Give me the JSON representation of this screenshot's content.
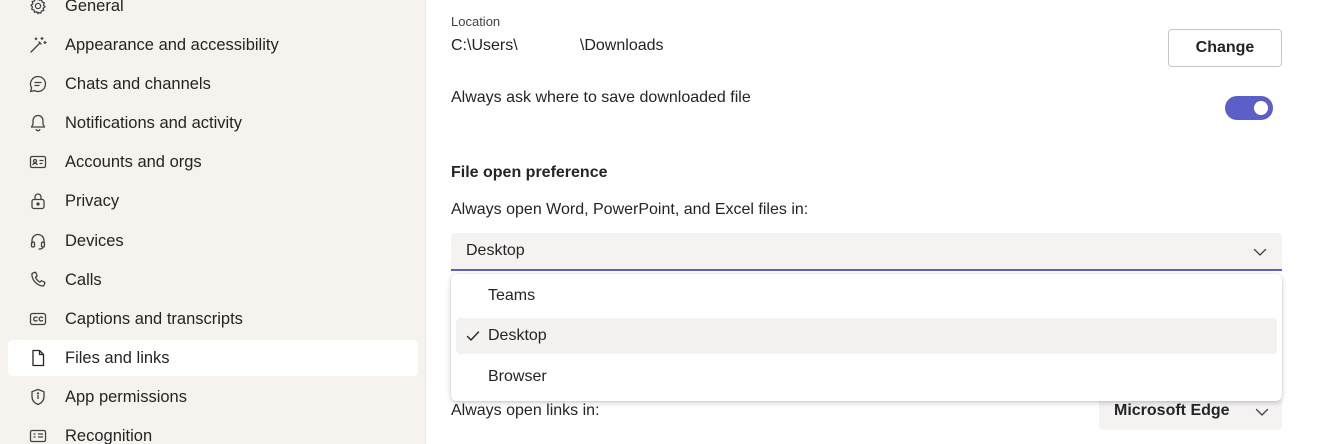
{
  "sidebar": {
    "items": [
      {
        "label": "General",
        "icon": "gear-icon"
      },
      {
        "label": "Appearance and accessibility",
        "icon": "magic-wand-icon"
      },
      {
        "label": "Chats and channels",
        "icon": "chat-icon"
      },
      {
        "label": "Notifications and activity",
        "icon": "bell-icon"
      },
      {
        "label": "Accounts and orgs",
        "icon": "id-card-icon"
      },
      {
        "label": "Privacy",
        "icon": "lock-icon"
      },
      {
        "label": "Devices",
        "icon": "headset-icon"
      },
      {
        "label": "Calls",
        "icon": "phone-icon"
      },
      {
        "label": "Captions and transcripts",
        "icon": "closed-caption-icon"
      },
      {
        "label": "Files and links",
        "icon": "document-icon",
        "selected": true
      },
      {
        "label": "App permissions",
        "icon": "shield-icon"
      },
      {
        "label": "Recognition",
        "icon": "recognition-icon"
      }
    ]
  },
  "main": {
    "location_label": "Location",
    "location_value": "C:\\Users\\              \\Downloads",
    "change_button": "Change",
    "ask_label": "Always ask where to save downloaded file",
    "ask_toggle_on": true,
    "file_open_heading": "File open preference",
    "open_in_label": "Always open Word, PowerPoint, and Excel files in:",
    "open_in_value": "Desktop",
    "open_in_options": [
      {
        "label": "Teams",
        "selected": false
      },
      {
        "label": "Desktop",
        "selected": true
      },
      {
        "label": "Browser",
        "selected": false
      }
    ],
    "links_label": "Always open links in:",
    "links_value": "Microsoft Edge"
  },
  "colors": {
    "accent": "#5b5fc7",
    "sidebar_bg": "#f6f3ef",
    "text": "#242424"
  }
}
